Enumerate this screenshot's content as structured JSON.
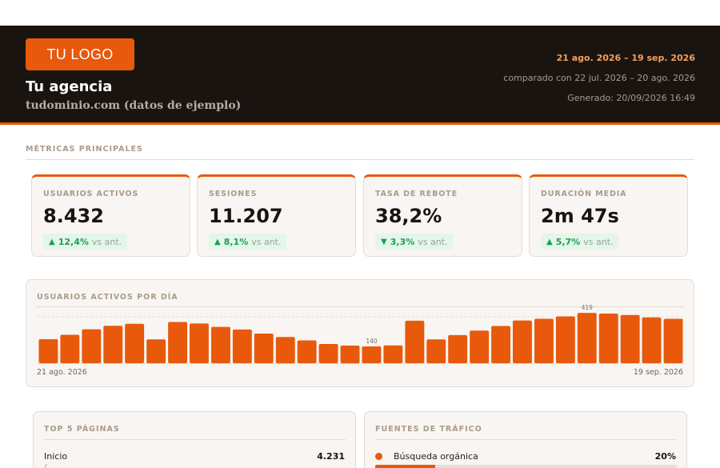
{
  "header": {
    "logo": "TU LOGO",
    "agency": "Tu agencia",
    "domain": "tudominio.com (datos de ejemplo)",
    "date_range": "21 ago. 2026 – 19 sep. 2026",
    "compare": "comparado con 22 jul. 2026 – 20 ago. 2026",
    "generated": "Generado: 20/09/2026 16:49"
  },
  "colors": {
    "accent": "#e8590c",
    "header_bg": "#1a1411",
    "positive": "#1f9d55"
  },
  "main_metrics": {
    "title": "MÉTRICAS PRINCIPALES",
    "kpis": [
      {
        "label": "USUARIOS ACTIVOS",
        "value": "8.432",
        "arrow": "▲",
        "delta": "12,4%",
        "vs": "vs ant."
      },
      {
        "label": "SESIONES",
        "value": "11.207",
        "arrow": "▲",
        "delta": "8,1%",
        "vs": "vs ant."
      },
      {
        "label": "TASA DE REBOTE",
        "value": "38,2%",
        "arrow": "▼",
        "delta": "3,3%",
        "vs": "vs ant."
      },
      {
        "label": "DURACIÓN MEDIA",
        "value": "2m 47s",
        "arrow": "▲",
        "delta": "5,7%",
        "vs": "vs ant."
      }
    ]
  },
  "daily_chart": {
    "title": "USUARIOS ACTIVOS POR DÍA",
    "start_label": "21 ago. 2026",
    "end_label": "19 sep. 2026"
  },
  "chart_data": {
    "type": "bar",
    "title": "USUARIOS ACTIVOS POR DÍA",
    "values": [
      200,
      237,
      283,
      312,
      328,
      198,
      343,
      331,
      303,
      281,
      247,
      219,
      190,
      160,
      147,
      140,
      148,
      354,
      198,
      234,
      272,
      310,
      356,
      370,
      390,
      419,
      413,
      402,
      382,
      370
    ],
    "labeled_points": [
      {
        "index": 15,
        "label": "140"
      },
      {
        "index": 25,
        "label": "419"
      }
    ],
    "x_start": "21 ago. 2026",
    "x_end": "19 sep. 2026",
    "ylim": [
      0,
      560
    ],
    "grid": "dashed"
  },
  "top_pages": {
    "title": "TOP 5 PÁGINAS",
    "items": [
      {
        "label": "Inicio",
        "path": "/",
        "value": "4.231"
      }
    ]
  },
  "traffic_sources": {
    "title": "FUENTES DE TRÁFICO",
    "items": [
      {
        "label": "Búsqueda orgánica",
        "pct": "20%",
        "fraction": 0.2
      }
    ]
  }
}
